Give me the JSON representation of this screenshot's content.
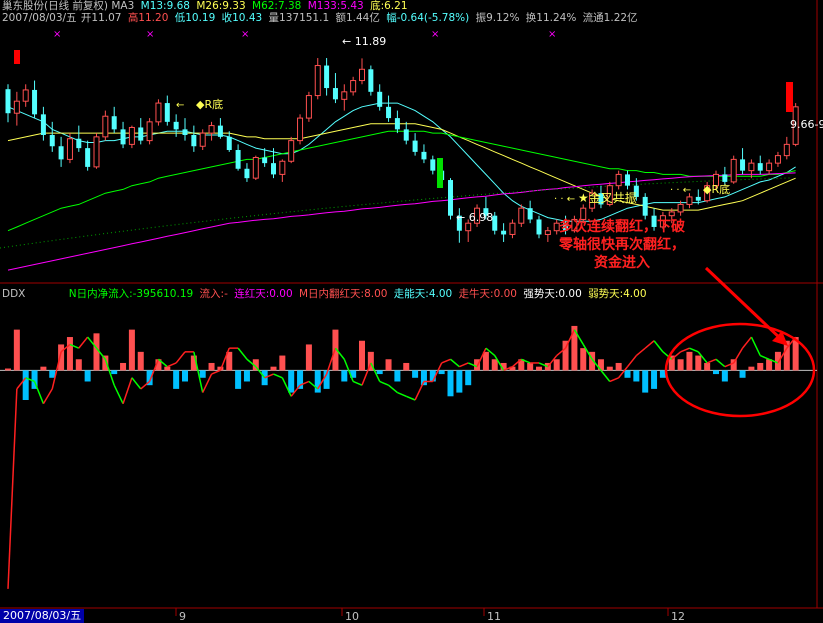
{
  "header": {
    "stock_label": "巢东股份(日线 前复权) MA3",
    "date_wd": "2007/08/03/五",
    "open": "开11.07",
    "high": "高11.20",
    "low": "低10.19",
    "close": "收10.43",
    "vol": "量137151.1",
    "amt": "额1.44亿",
    "chg": "幅-0.64(-5.78%)",
    "amp": "振9.12%",
    "turn": "换11.24%",
    "float": "流通1.22亿",
    "m13": "M13:9.68",
    "m26": "M26:9.33",
    "m62": "M62:7.38",
    "m133": "M133:5.43",
    "bottom": "底:6.21"
  },
  "ddx": {
    "name": "DDX",
    "net_inflow": "N日内净流入:-395610.19",
    "inflow": "流入:-",
    "lianhong": "连红天:0.00",
    "fanhong": "M日内翻红天:8.00",
    "zouneng": "走能天:4.00",
    "zouniu": "走牛天:0.00",
    "qiangshi": "强势天:0.00",
    "ruoshi": "弱势天:4.00"
  },
  "annotations": {
    "high_label": "11.89",
    "low_label": "6.98",
    "last_label": "9.66-9",
    "golden_cross": "金叉共振",
    "r_bottom_1": "R底",
    "r_bottom_2": "R底",
    "note_lines": [
      "多次连续翻红，下破",
      "零轴很快再次翻红，",
      "资金进入"
    ]
  },
  "date_box": "2007/08/03/五",
  "month_labels": [
    "9",
    "10",
    "11",
    "12"
  ],
  "colors": {
    "up": "#ff5050",
    "down": "#54ffff",
    "ma13": "#54ffff",
    "ma26": "#ffff54",
    "ma62": "#00ff00",
    "ma133": "#ff00ff",
    "ddx_up": "#ff5050",
    "ddx_down": "#00c0ff",
    "note": "#ff2020"
  },
  "chart_data": [
    {
      "type": "candlestick",
      "ylim": [
        6.2,
        12.7
      ],
      "candles": [
        [
          11.07,
          11.2,
          10.19,
          10.43
        ],
        [
          10.43,
          11.0,
          10.1,
          10.75
        ],
        [
          10.75,
          11.2,
          10.6,
          11.05
        ],
        [
          11.05,
          11.3,
          10.3,
          10.4
        ],
        [
          10.4,
          10.6,
          9.7,
          9.85
        ],
        [
          9.85,
          10.2,
          9.4,
          9.55
        ],
        [
          9.55,
          9.8,
          9.0,
          9.2
        ],
        [
          9.2,
          9.9,
          9.1,
          9.75
        ],
        [
          9.75,
          10.1,
          9.4,
          9.5
        ],
        [
          9.5,
          9.7,
          8.9,
          9.0
        ],
        [
          9.0,
          9.9,
          8.95,
          9.8
        ],
        [
          9.8,
          10.5,
          9.7,
          10.35
        ],
        [
          10.35,
          10.6,
          9.9,
          10.0
        ],
        [
          10.0,
          10.2,
          9.5,
          9.6
        ],
        [
          9.6,
          10.1,
          9.5,
          10.05
        ],
        [
          10.05,
          10.3,
          9.6,
          9.7
        ],
        [
          9.7,
          10.3,
          9.6,
          10.2
        ],
        [
          10.2,
          10.8,
          10.1,
          10.7
        ],
        [
          10.7,
          10.9,
          10.1,
          10.2
        ],
        [
          10.2,
          10.4,
          9.8,
          10.0
        ],
        [
          10.0,
          10.3,
          9.7,
          9.85
        ],
        [
          9.85,
          10.1,
          9.4,
          9.55
        ],
        [
          9.55,
          10.0,
          9.45,
          9.9
        ],
        [
          9.9,
          10.2,
          9.7,
          10.1
        ],
        [
          10.1,
          10.3,
          9.75,
          9.8
        ],
        [
          9.8,
          9.95,
          9.4,
          9.45
        ],
        [
          9.45,
          9.6,
          8.9,
          8.95
        ],
        [
          8.95,
          9.1,
          8.6,
          8.7
        ],
        [
          8.7,
          9.3,
          8.65,
          9.25
        ],
        [
          9.25,
          9.5,
          9.0,
          9.1
        ],
        [
          9.1,
          9.5,
          8.7,
          8.8
        ],
        [
          8.8,
          9.2,
          8.6,
          9.15
        ],
        [
          9.15,
          9.8,
          9.1,
          9.7
        ],
        [
          9.7,
          10.4,
          9.6,
          10.3
        ],
        [
          10.3,
          11.0,
          10.2,
          10.9
        ],
        [
          10.9,
          11.9,
          10.8,
          11.7
        ],
        [
          11.7,
          11.9,
          10.9,
          11.1
        ],
        [
          11.1,
          11.5,
          10.7,
          10.8
        ],
        [
          10.8,
          11.2,
          10.5,
          11.0
        ],
        [
          11.0,
          11.4,
          10.9,
          11.3
        ],
        [
          11.3,
          11.89,
          11.2,
          11.6
        ],
        [
          11.6,
          11.7,
          10.9,
          11.0
        ],
        [
          11.0,
          11.2,
          10.5,
          10.6
        ],
        [
          10.6,
          10.9,
          10.2,
          10.3
        ],
        [
          10.3,
          10.5,
          9.9,
          10.0
        ],
        [
          10.0,
          10.2,
          9.6,
          9.7
        ],
        [
          9.7,
          9.9,
          9.3,
          9.4
        ],
        [
          9.4,
          9.6,
          9.1,
          9.2
        ],
        [
          9.2,
          9.3,
          8.8,
          8.9
        ],
        [
          8.9,
          9.1,
          8.6,
          8.65
        ],
        [
          8.65,
          8.7,
          7.6,
          7.7
        ],
        [
          7.7,
          7.9,
          6.98,
          7.3
        ],
        [
          7.3,
          7.6,
          7.0,
          7.5
        ],
        [
          7.5,
          8.0,
          7.4,
          7.9
        ],
        [
          7.9,
          8.2,
          7.6,
          7.7
        ],
        [
          7.7,
          7.8,
          7.2,
          7.3
        ],
        [
          7.3,
          7.5,
          7.0,
          7.2
        ],
        [
          7.2,
          7.6,
          7.1,
          7.5
        ],
        [
          7.5,
          8.0,
          7.4,
          7.9
        ],
        [
          7.9,
          8.1,
          7.5,
          7.6
        ],
        [
          7.6,
          7.7,
          7.1,
          7.2
        ],
        [
          7.2,
          7.4,
          7.0,
          7.3
        ],
        [
          7.3,
          7.6,
          7.2,
          7.5
        ],
        [
          7.5,
          7.7,
          7.2,
          7.3
        ],
        [
          7.3,
          7.7,
          7.25,
          7.6
        ],
        [
          7.6,
          8.0,
          7.5,
          7.9
        ],
        [
          7.9,
          8.4,
          7.8,
          8.3
        ],
        [
          8.3,
          8.5,
          7.9,
          8.0
        ],
        [
          8.0,
          8.6,
          7.95,
          8.5
        ],
        [
          8.5,
          8.9,
          8.4,
          8.8
        ],
        [
          8.8,
          8.9,
          8.4,
          8.5
        ],
        [
          8.5,
          8.7,
          8.1,
          8.2
        ],
        [
          8.2,
          8.3,
          7.6,
          7.7
        ],
        [
          7.7,
          7.9,
          7.3,
          7.4
        ],
        [
          7.4,
          7.8,
          7.35,
          7.7
        ],
        [
          7.7,
          7.9,
          7.5,
          7.8
        ],
        [
          7.8,
          8.1,
          7.7,
          8.0
        ],
        [
          8.0,
          8.3,
          7.9,
          8.2
        ],
        [
          8.2,
          8.4,
          8.0,
          8.1
        ],
        [
          8.1,
          8.6,
          8.05,
          8.5
        ],
        [
          8.5,
          8.9,
          8.4,
          8.8
        ],
        [
          8.8,
          9.0,
          8.5,
          8.6
        ],
        [
          8.6,
          9.3,
          8.55,
          9.2
        ],
        [
          9.2,
          9.5,
          8.8,
          8.9
        ],
        [
          8.9,
          9.2,
          8.7,
          9.1
        ],
        [
          9.1,
          9.3,
          8.8,
          8.9
        ],
        [
          8.9,
          9.2,
          8.8,
          9.1
        ],
        [
          9.1,
          9.4,
          9.0,
          9.3
        ],
        [
          9.3,
          9.8,
          9.2,
          9.6
        ],
        [
          9.6,
          10.7,
          9.55,
          10.6
        ]
      ],
      "ma_series": [
        {
          "name": "M13",
          "values": [
            10.6,
            10.5,
            10.4,
            10.3,
            10.2,
            10.0,
            9.9,
            9.8,
            9.7,
            9.65,
            9.65,
            9.7,
            9.7,
            9.75,
            9.8,
            9.8,
            9.85,
            9.9,
            9.95,
            9.95,
            9.95,
            9.9,
            9.85,
            9.85,
            9.85,
            9.8,
            9.7,
            9.6,
            9.5,
            9.45,
            9.4,
            9.35,
            9.35,
            9.45,
            9.6,
            9.8,
            10.0,
            10.2,
            10.35,
            10.5,
            10.6,
            10.65,
            10.7,
            10.7,
            10.7,
            10.6,
            10.5,
            10.35,
            10.2,
            10.0,
            9.8,
            9.55,
            9.3,
            9.05,
            8.8,
            8.55,
            8.3,
            8.1,
            7.95,
            7.85,
            7.75,
            7.65,
            7.6,
            7.55,
            7.55,
            7.55,
            7.55,
            7.6,
            7.7,
            7.8,
            7.9,
            7.95,
            8.0,
            8.05,
            8.05,
            8.05,
            8.05,
            8.05,
            8.05,
            8.1,
            8.15,
            8.2,
            8.3,
            8.4,
            8.5,
            8.6,
            8.65,
            8.75,
            8.85,
            9.0
          ]
        },
        {
          "name": "M26",
          "values": [
            9.7,
            9.75,
            9.8,
            9.85,
            9.9,
            9.9,
            9.9,
            9.9,
            9.9,
            9.9,
            9.9,
            9.9,
            9.9,
            9.9,
            9.9,
            9.9,
            9.9,
            9.9,
            9.9,
            9.9,
            9.9,
            9.9,
            9.9,
            9.9,
            9.9,
            9.9,
            9.85,
            9.8,
            9.8,
            9.75,
            9.75,
            9.75,
            9.75,
            9.75,
            9.8,
            9.85,
            9.9,
            9.95,
            10.0,
            10.05,
            10.1,
            10.15,
            10.15,
            10.15,
            10.15,
            10.15,
            10.15,
            10.1,
            10.05,
            10.0,
            9.9,
            9.8,
            9.7,
            9.6,
            9.5,
            9.4,
            9.3,
            9.2,
            9.1,
            9.0,
            8.9,
            8.8,
            8.7,
            8.6,
            8.5,
            8.4,
            8.3,
            8.2,
            8.15,
            8.1,
            8.05,
            8.0,
            7.95,
            7.9,
            7.85,
            7.85,
            7.85,
            7.85,
            7.85,
            7.9,
            7.95,
            8.0,
            8.05,
            8.1,
            8.2,
            8.3,
            8.4,
            8.5,
            8.6,
            8.7
          ]
        },
        {
          "name": "M62",
          "values": [
            7.3,
            7.4,
            7.5,
            7.6,
            7.7,
            7.8,
            7.9,
            7.95,
            8.0,
            8.1,
            8.2,
            8.3,
            8.35,
            8.4,
            8.5,
            8.55,
            8.6,
            8.7,
            8.75,
            8.8,
            8.85,
            8.9,
            8.95,
            9.0,
            9.05,
            9.1,
            9.15,
            9.2,
            9.2,
            9.25,
            9.3,
            9.35,
            9.4,
            9.45,
            9.5,
            9.55,
            9.6,
            9.65,
            9.7,
            9.75,
            9.8,
            9.85,
            9.9,
            9.95,
            9.95,
            9.95,
            9.95,
            9.95,
            9.9,
            9.9,
            9.85,
            9.8,
            9.75,
            9.7,
            9.65,
            9.6,
            9.55,
            9.5,
            9.45,
            9.4,
            9.35,
            9.3,
            9.25,
            9.2,
            9.15,
            9.1,
            9.05,
            9.0,
            8.95,
            8.95,
            8.9,
            8.9,
            8.85,
            8.85,
            8.8,
            8.8,
            8.8,
            8.75,
            8.75,
            8.75,
            8.75,
            8.75,
            8.75,
            8.75,
            8.75,
            8.75,
            8.8,
            8.8,
            8.85,
            8.9
          ]
        },
        {
          "name": "M133",
          "values": [
            6.25,
            6.3,
            6.35,
            6.4,
            6.45,
            6.5,
            6.55,
            6.6,
            6.65,
            6.7,
            6.75,
            6.8,
            6.85,
            6.9,
            6.95,
            7.0,
            7.05,
            7.1,
            7.15,
            7.2,
            7.25,
            7.3,
            7.35,
            7.4,
            7.45,
            7.5,
            7.52,
            7.55,
            7.58,
            7.6,
            7.62,
            7.65,
            7.68,
            7.7,
            7.72,
            7.75,
            7.78,
            7.8,
            7.82,
            7.85,
            7.88,
            7.9,
            7.92,
            7.95,
            7.98,
            8.0,
            8.02,
            8.05,
            8.08,
            8.1,
            8.12,
            8.15,
            8.18,
            8.2,
            8.22,
            8.25,
            8.28,
            8.3,
            8.32,
            8.35,
            8.38,
            8.4,
            8.42,
            8.45,
            8.47,
            8.5,
            8.52,
            8.54,
            8.56,
            8.58,
            8.6,
            8.62,
            8.64,
            8.66,
            8.68,
            8.7,
            8.72,
            8.74,
            8.75,
            8.76,
            8.77,
            8.78,
            8.79,
            8.8,
            8.8,
            8.8,
            8.81,
            8.82,
            8.83,
            8.84
          ]
        }
      ]
    },
    {
      "type": "bar+line",
      "name": "DDX",
      "ylim": [
        -6.2,
        1.9
      ],
      "bars": [
        0.05,
        1.1,
        -0.8,
        -0.5,
        0.1,
        -0.2,
        0.7,
        0.9,
        0.3,
        -0.3,
        1.0,
        0.4,
        -0.1,
        0.2,
        1.1,
        0.5,
        -0.4,
        0.3,
        0.1,
        -0.5,
        -0.3,
        0.4,
        -0.2,
        0.2,
        0.1,
        0.5,
        -0.5,
        -0.3,
        0.3,
        -0.4,
        0.1,
        0.4,
        -0.6,
        -0.5,
        0.7,
        -0.6,
        -0.5,
        1.1,
        -0.3,
        -0.2,
        0.8,
        0.5,
        -0.1,
        0.3,
        -0.3,
        0.2,
        -0.2,
        -0.4,
        -0.3,
        -0.1,
        -0.7,
        -0.6,
        -0.4,
        0.3,
        0.5,
        0.3,
        0.2,
        0.1,
        0.3,
        0.2,
        0.1,
        0.2,
        0.3,
        0.8,
        1.2,
        0.6,
        0.5,
        0.3,
        0.1,
        0.2,
        -0.2,
        -0.3,
        -0.6,
        -0.5,
        -0.2,
        0.4,
        0.3,
        0.5,
        0.4,
        0.2,
        -0.1,
        -0.3,
        0.3,
        -0.2,
        0.1,
        0.2,
        0.3,
        0.5,
        0.8,
        0.9
      ],
      "line": [
        -5.9,
        -0.5,
        -0.2,
        -0.3,
        -0.9,
        -0.5,
        0.5,
        0.7,
        0.6,
        0.9,
        0.6,
        0.3,
        -0.4,
        -0.9,
        -0.2,
        -0.5,
        -0.3,
        0.3,
        0.1,
        0.2,
        0.5,
        0.5,
        -0.6,
        -0.1,
        0.0,
        0.6,
        0.6,
        0.3,
        0.1,
        -0.2,
        -0.1,
        -0.2,
        -0.7,
        -0.4,
        -0.3,
        -0.5,
        -0.1,
        0.6,
        0.3,
        -0.3,
        -0.4,
        0.2,
        -0.3,
        -0.4,
        -0.6,
        -0.7,
        -0.8,
        -0.3,
        -0.3,
        0.2,
        0.3,
        0.1,
        0.2,
        0.1,
        0.6,
        0.4,
        0.0,
        0.1,
        0.3,
        0.2,
        0.2,
        0.1,
        0.4,
        0.6,
        1.1,
        0.7,
        0.3,
        0.0,
        -0.3,
        -0.2,
        0.1,
        0.4,
        0.6,
        0.8,
        0.5,
        0.3,
        0.5,
        0.6,
        0.5,
        0.2,
        0.3,
        0.1,
        0.2,
        0.6,
        0.9,
        0.4,
        0.3,
        0.2,
        0.6,
        0.9
      ]
    }
  ]
}
